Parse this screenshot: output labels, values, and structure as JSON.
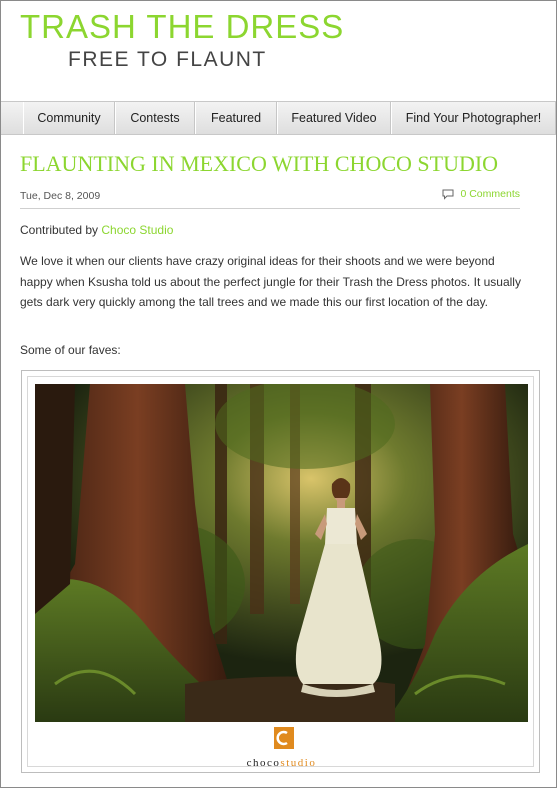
{
  "header": {
    "site_title": "TRASH THE DRESS",
    "tagline": "FREE TO FLAUNT"
  },
  "nav": {
    "items": [
      "Community",
      "Contests",
      "Featured",
      "Featured Video",
      "Find Your Photographer!"
    ]
  },
  "post": {
    "title": "FLAUNTING IN MEXICO WITH CHOCO STUDIO",
    "date": "Tue, Dec 8, 2009",
    "comments_label": "0 Comments",
    "contributed_prefix": "Contributed by",
    "contributor": "Choco Studio",
    "paragraph": "We love it when our clients have crazy original ideas for their shoots and we were beyond happy when Ksusha told us about the perfect jungle for their Trash the Dress photos. It usually gets dark very quickly among the tall trees and we made this our first location of the day.",
    "faves_label": "Some of our faves:"
  },
  "photo": {
    "logo_part1": "choco",
    "logo_part2": "studio"
  },
  "colors": {
    "accent_green": "#8cd630",
    "logo_orange": "#e08a1e"
  }
}
